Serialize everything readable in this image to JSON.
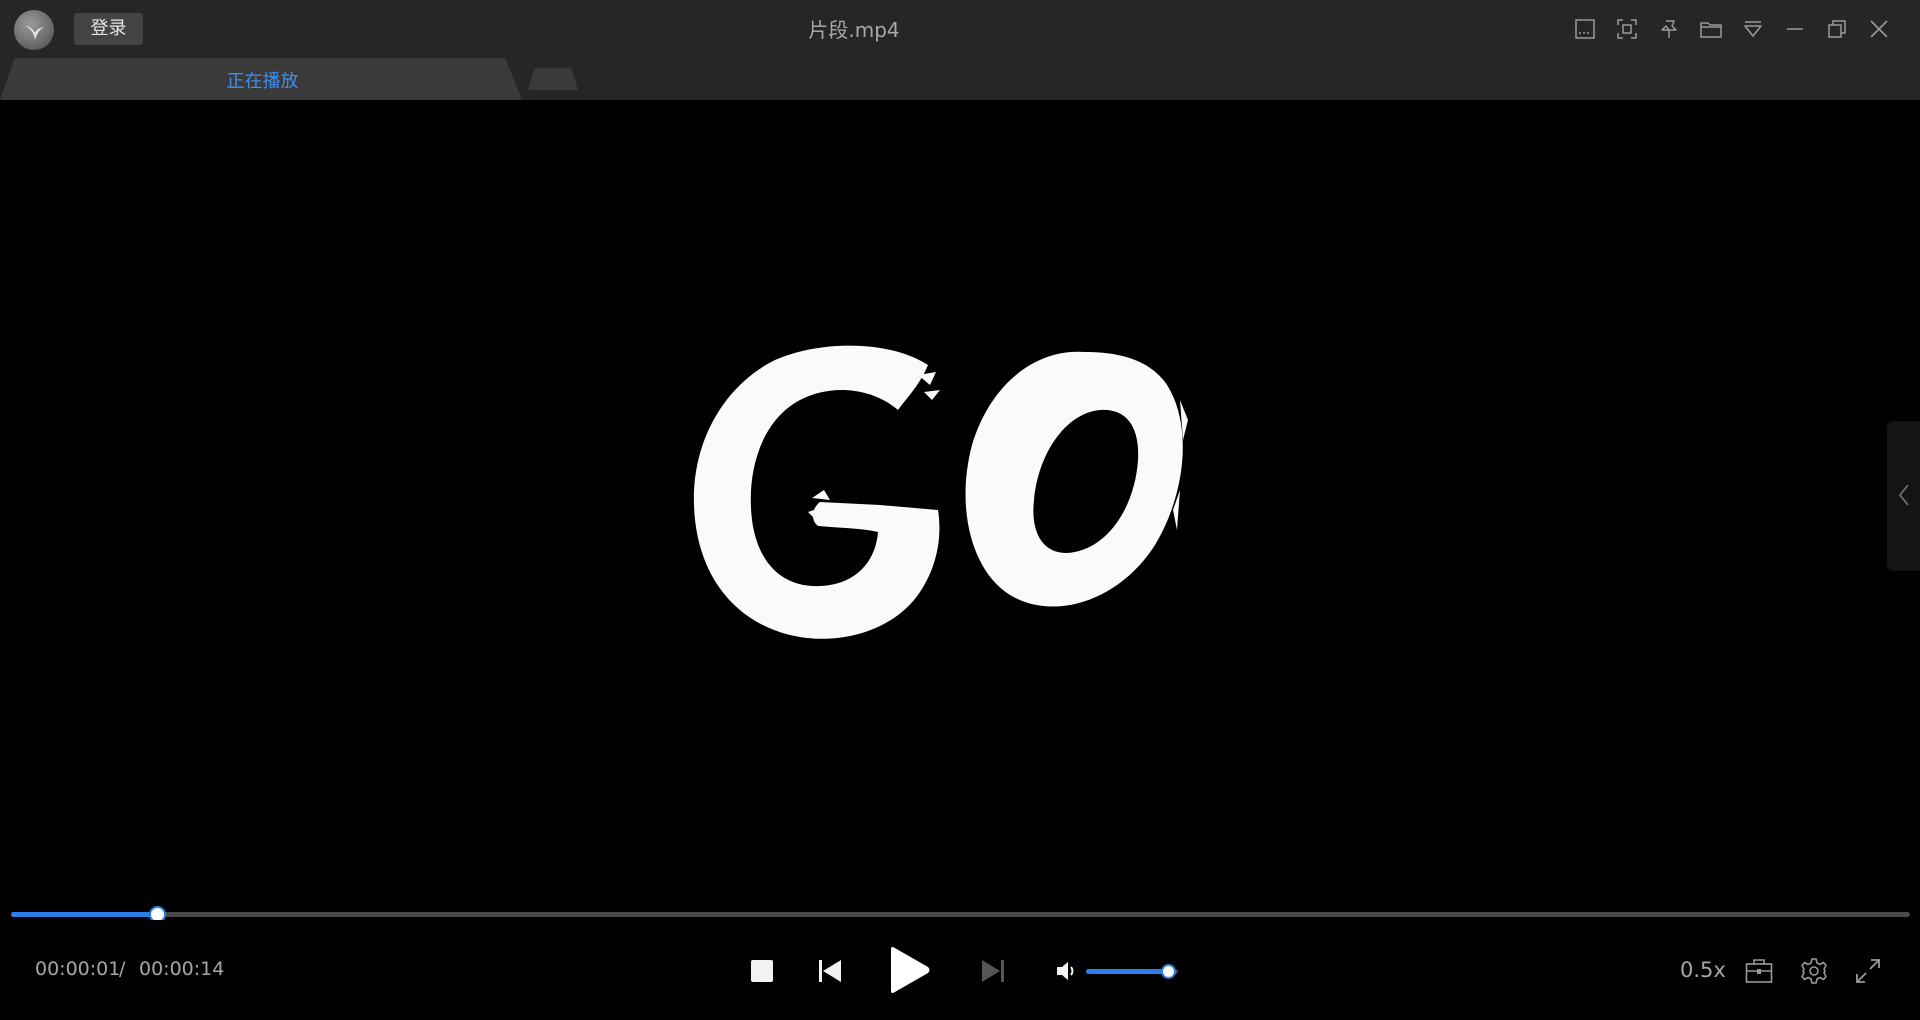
{
  "titlebar": {
    "login_label": "登录",
    "file_title": "片段.mp4",
    "buttons": [
      {
        "name": "subtitle-icon"
      },
      {
        "name": "screenshot-icon"
      },
      {
        "name": "pin-icon"
      },
      {
        "name": "folder-icon"
      },
      {
        "name": "menu-dropdown-icon"
      },
      {
        "name": "minimize-icon"
      },
      {
        "name": "restore-icon"
      },
      {
        "name": "close-icon"
      }
    ]
  },
  "tabs": {
    "active_label": "正在播放"
  },
  "video": {
    "frame_text": "GO"
  },
  "playback": {
    "current_time": "00:00:01",
    "separator": "/",
    "total_time": "00:00:14",
    "progress": 0.077,
    "volume": 0.88,
    "speed": "0.5x"
  },
  "colors": {
    "accent": "#2a7ee8",
    "tab_label": "#3d8ef0",
    "titlebar_bg": "#262626",
    "video_bg": "#000000"
  }
}
